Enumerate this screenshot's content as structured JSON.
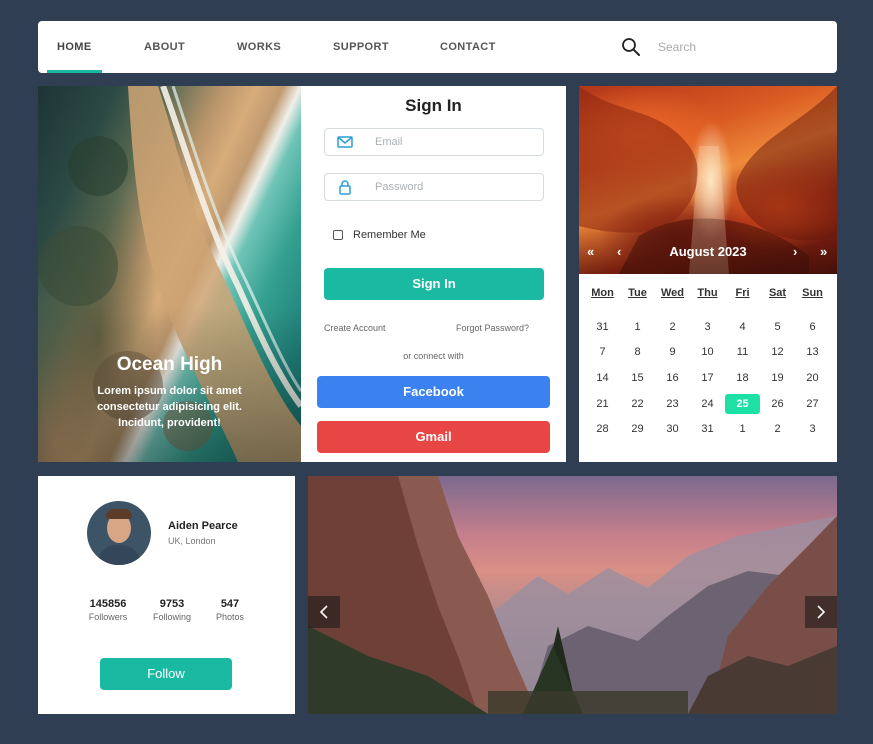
{
  "nav": {
    "items": [
      {
        "label": "HOME",
        "active": true
      },
      {
        "label": "ABOUT",
        "active": false
      },
      {
        "label": "WORKS",
        "active": false
      },
      {
        "label": "SUPPORT",
        "active": false
      },
      {
        "label": "CONTACT",
        "active": false
      }
    ],
    "search_placeholder": "Search",
    "search_icon": "search-icon"
  },
  "hero": {
    "title": "Ocean High",
    "text": "Lorem ipsum dolor sit amet consectetur adipisicing elit. Incidunt, provident!"
  },
  "signin": {
    "title": "Sign In",
    "email_placeholder": "Email",
    "password_placeholder": "Password",
    "email_icon": "mail-icon",
    "password_icon": "lock-icon",
    "remember_label": "Remember Me",
    "remember_checked": false,
    "submit_label": "Sign In",
    "create_account": "Create Account",
    "forgot_password": "Forgot Password?",
    "connect_text": "or connect with",
    "facebook_label": "Facebook",
    "gmail_label": "Gmail"
  },
  "calendar": {
    "month": "August 2023",
    "nav": {
      "first": "«",
      "prev": "‹",
      "next": "›",
      "last": "»"
    },
    "weekdays": [
      "Mon",
      "Tue",
      "Wed",
      "Thu",
      "Fri",
      "Sat",
      "Sun"
    ],
    "weeks": [
      [
        "31",
        "1",
        "2",
        "3",
        "4",
        "5",
        "6"
      ],
      [
        "7",
        "8",
        "9",
        "10",
        "11",
        "12",
        "13"
      ],
      [
        "14",
        "15",
        "16",
        "17",
        "18",
        "19",
        "20"
      ],
      [
        "21",
        "22",
        "23",
        "24",
        "25",
        "26",
        "27"
      ],
      [
        "28",
        "29",
        "30",
        "31",
        "1",
        "2",
        "3"
      ]
    ],
    "selected_day": "25",
    "selected_color": "#1de0a5"
  },
  "profile": {
    "name": "Aiden Pearce",
    "location": "UK, London",
    "stats": [
      {
        "value": "145856",
        "label": "Followers"
      },
      {
        "value": "9753",
        "label": "Following"
      },
      {
        "value": "547",
        "label": "Photos"
      }
    ],
    "follow_label": "Follow"
  },
  "slider": {
    "prev_icon": "chevron-left-icon",
    "next_icon": "chevron-right-icon"
  },
  "colors": {
    "background": "#2f3e52",
    "accent": "#1ab9a2",
    "facebook": "#3b82f0",
    "gmail": "#e84545"
  }
}
